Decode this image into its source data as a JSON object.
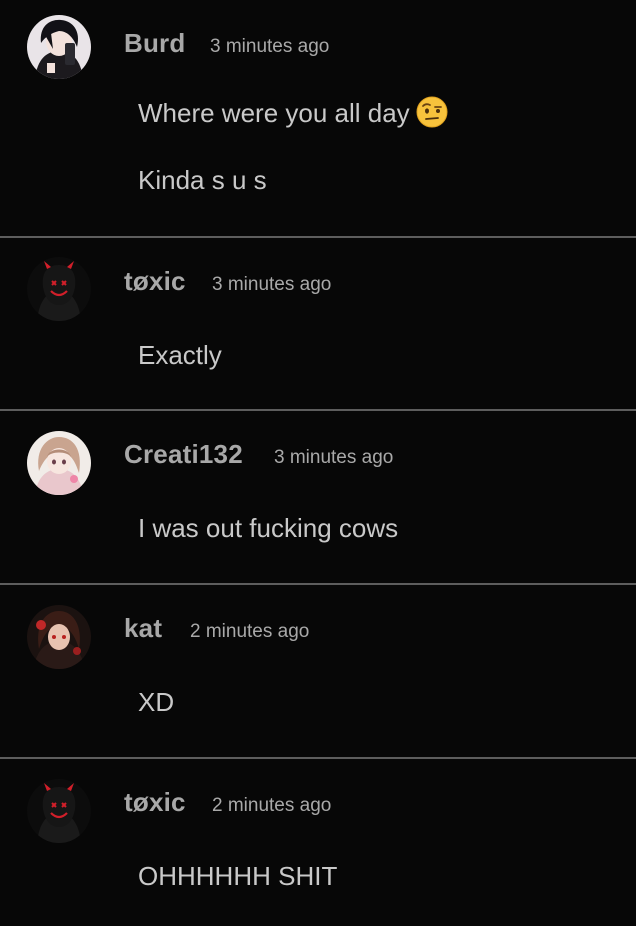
{
  "comments": [
    {
      "author": "Burd",
      "time": "3 minutes ago",
      "lines": [
        "Where were you all day",
        "Kinda s u s"
      ],
      "emoji": "raised-eyebrow-emoji",
      "avatar": "anime-boy-avatar"
    },
    {
      "author": "tøxic",
      "time": "3 minutes ago",
      "lines": [
        "Exactly"
      ],
      "avatar": "red-devil-mask-avatar"
    },
    {
      "author": "Creati132",
      "time": "3 minutes ago",
      "lines": [
        "I was out fucking cows"
      ],
      "avatar": "anime-girl-avatar"
    },
    {
      "author": "kat",
      "time": "2 minutes ago",
      "lines": [
        "XD"
      ],
      "avatar": "anime-girl-red-avatar"
    },
    {
      "author": "tøxic",
      "time": "2 minutes ago",
      "lines": [
        "OHHHHHH SHIT"
      ],
      "avatar": "red-devil-mask-avatar"
    }
  ],
  "colors": {
    "background": "#070707",
    "divider": "#5d5d5d",
    "author": "#a8a8a8",
    "text": "#c9c9c9",
    "devil_red": "#d21f2a"
  }
}
